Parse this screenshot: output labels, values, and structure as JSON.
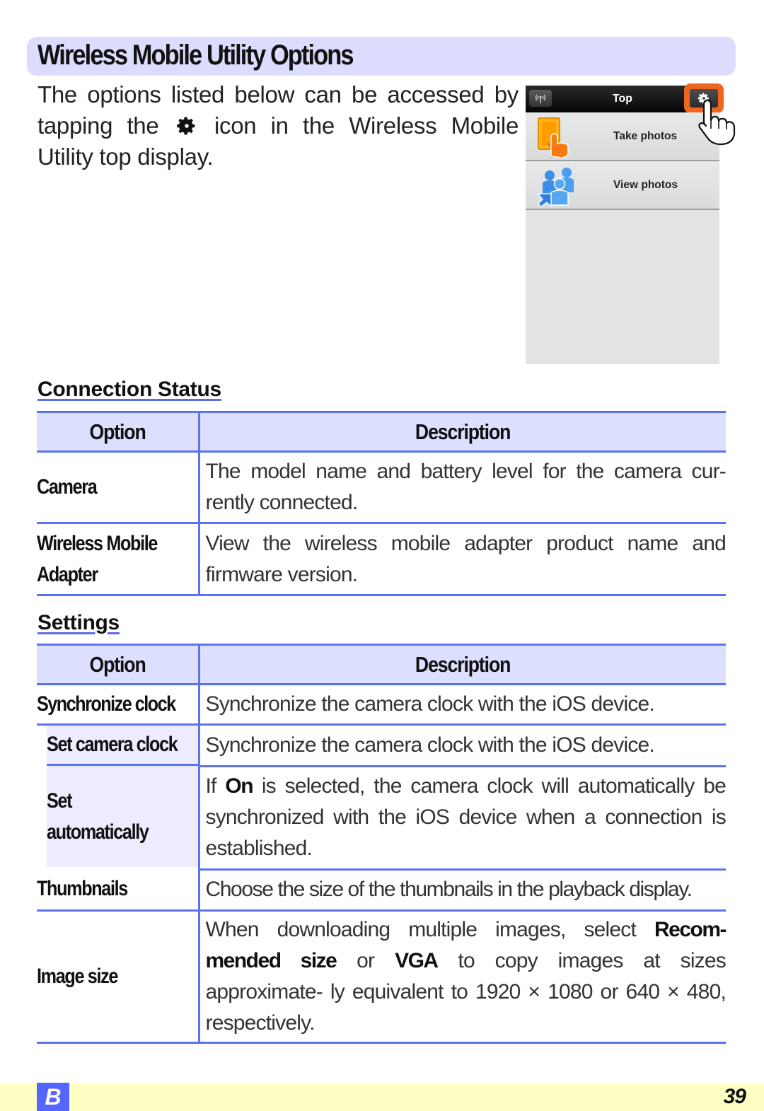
{
  "page": {
    "title": "Wireless Mobile Utility Options",
    "intro": {
      "line1": "The options listed below can be accessed by",
      "line2_before": "tapping the",
      "line2_icon": "gear-icon",
      "line2_after": "icon in the Wireless Mobile",
      "line3": "Utility top display."
    },
    "colors": {
      "title_bar": "#dcdcfe",
      "table_border": "#5b73ef",
      "table_header_bg": "#dcdffe",
      "sub_option_bg": "#ececfe",
      "highlight": "#f0651e",
      "footer_bg": "#ffffc4",
      "chapter_tab": "#5466ff"
    }
  },
  "phone_screen": {
    "nav_title": "Top",
    "left_button_icon": "antenna-icon",
    "right_button_icon": "gear-icon",
    "menu": [
      {
        "label": "Take photos",
        "icon": "take-photos-icon"
      },
      {
        "label": "View photos",
        "icon": "view-photos-icon"
      }
    ]
  },
  "connection_status": {
    "heading": "Connection Status",
    "headers": {
      "option": "Option",
      "description": "Description"
    },
    "rows": [
      {
        "option": "Camera",
        "description": "The model name and battery level for the camera cur- rently connected."
      },
      {
        "option": "Wireless Mobile Adapter",
        "description": "View the wireless mobile adapter product name and firmware version."
      }
    ]
  },
  "settings": {
    "heading": "Settings",
    "headers": {
      "option": "Option",
      "description": "Description"
    },
    "rows": [
      {
        "option": "Synchronize clock",
        "description": "Synchronize the camera clock with the iOS device."
      },
      {
        "option": "Set camera clock",
        "sub": true,
        "description": "Synchronize the camera clock with the iOS device."
      },
      {
        "option": "Set automatically",
        "sub": true,
        "desc_pre": "If",
        "desc_bold": "On",
        "desc_post": "is selected, the camera clock will automatically be synchronized with the iOS device when a connection is established."
      },
      {
        "option": "Thumbnails",
        "description": "Choose the size of the thumbnails in the playback display."
      },
      {
        "option": "Image size",
        "desc_pre": "When downloading multiple images, select",
        "desc_bold1": "Recom- mended size",
        "desc_mid": "or",
        "desc_bold2": "VGA",
        "desc_post": "to copy images at sizes approximate- ly equivalent to 1920 × 1080 or 640 × 480, respectively."
      }
    ]
  },
  "footer": {
    "chapter": "B",
    "page_number": "39"
  }
}
